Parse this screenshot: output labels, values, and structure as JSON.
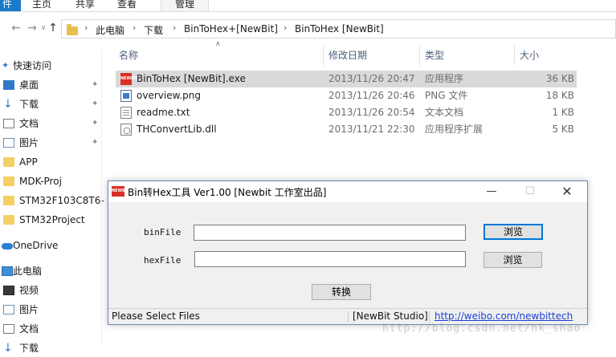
{
  "ribbon": {
    "tabs": [
      "件",
      "主页",
      "共享",
      "查看",
      "管理"
    ]
  },
  "address": {
    "crumbs": [
      "此电脑",
      "下载",
      "BinToHex+[NewBit]",
      "BinToHex [NewBit]"
    ]
  },
  "nav": {
    "items": [
      {
        "label": "快速访问",
        "icon": "star-icon"
      },
      {
        "label": "桌面",
        "icon": "desktop-icon",
        "pinned": true
      },
      {
        "label": "下载",
        "icon": "download-icon",
        "pinned": true
      },
      {
        "label": "文档",
        "icon": "document-icon",
        "pinned": true
      },
      {
        "label": "图片",
        "icon": "picture-icon",
        "pinned": true
      },
      {
        "label": "APP",
        "icon": "folder-icon"
      },
      {
        "label": "MDK-Proj",
        "icon": "folder-icon"
      },
      {
        "label": "STM32F103C8T6-",
        "icon": "folder-icon"
      },
      {
        "label": "STM32Project",
        "icon": "folder-icon"
      },
      {
        "label": "OneDrive",
        "icon": "cloud-icon"
      },
      {
        "label": "此电脑",
        "icon": "pc-icon"
      },
      {
        "label": "视频",
        "icon": "video-icon"
      },
      {
        "label": "图片",
        "icon": "picture-icon"
      },
      {
        "label": "文档",
        "icon": "document-icon"
      },
      {
        "label": "下载",
        "icon": "download-icon"
      }
    ]
  },
  "list": {
    "columns": [
      "名称",
      "修改日期",
      "类型",
      "大小"
    ],
    "files": [
      {
        "name": "BinToHex [NewBit].exe",
        "date": "2013/11/26 20:47",
        "type": "应用程序",
        "size": "36 KB",
        "icon": "exe-icon",
        "selected": true
      },
      {
        "name": "overview.png",
        "date": "2013/11/26 20:46",
        "type": "PNG 文件",
        "size": "18 KB",
        "icon": "png-icon"
      },
      {
        "name": "readme.txt",
        "date": "2013/11/26 20:54",
        "type": "文本文档",
        "size": "1 KB",
        "icon": "txt-icon"
      },
      {
        "name": "THConvertLib.dll",
        "date": "2013/11/21 22:30",
        "type": "应用程序扩展",
        "size": "5 KB",
        "icon": "dll-icon"
      }
    ]
  },
  "dialog": {
    "title": "Bin转Hex工具 Ver1.00 [Newbit 工作室出品]",
    "app_icon_text": "NEWBIT",
    "bin_label": "binFile",
    "hex_label": "hexFile",
    "bin_value": "",
    "hex_value": "",
    "browse1": "浏览",
    "browse2": "浏览",
    "convert": "转换",
    "status_left": "Please Select Files",
    "status_mid": "[NewBit Studio]",
    "status_link": "http://weibo.com/newbittech"
  },
  "watermark": "http://blog.csdn.net/hk_shao"
}
